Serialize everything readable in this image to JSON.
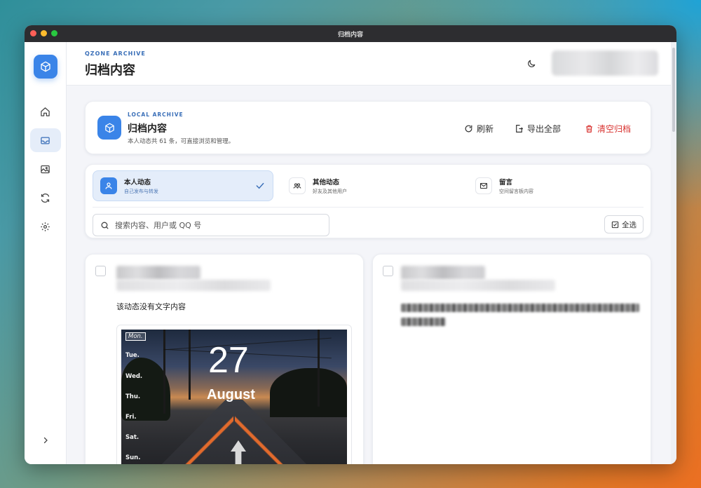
{
  "window": {
    "title": "归档内容"
  },
  "header": {
    "eyebrow": "QZONE ARCHIVE",
    "title": "归档内容"
  },
  "sidebar": {
    "items": [
      {
        "name": "home",
        "icon": "home-icon",
        "active": false
      },
      {
        "name": "archive",
        "icon": "inbox-icon",
        "active": true
      },
      {
        "name": "albums",
        "icon": "photo-icon",
        "active": false
      },
      {
        "name": "sync",
        "icon": "refresh-icon",
        "active": false
      },
      {
        "name": "settings",
        "icon": "gear-icon",
        "active": false
      }
    ]
  },
  "archive_card": {
    "eyebrow": "LOCAL ARCHIVE",
    "title": "归档内容",
    "subtitle": "本人动态共 61 条，可直接浏览和管理。",
    "actions": {
      "refresh": "刷新",
      "export": "导出全部",
      "clear": "清空归档"
    }
  },
  "tabs": [
    {
      "label": "本人动态",
      "desc": "自己发布与转发",
      "icon": "user-icon",
      "active": true
    },
    {
      "label": "其他动态",
      "desc": "好友及其他用户",
      "icon": "users-icon",
      "active": false
    },
    {
      "label": "留言",
      "desc": "空间留言板内容",
      "icon": "mail-icon",
      "active": false
    }
  ],
  "search": {
    "placeholder": "搜索内容、用户或 QQ 号"
  },
  "select_all_label": "全选",
  "posts": [
    {
      "text": "该动态没有文字内容",
      "image": {
        "days": [
          "Mon.",
          "Tue.",
          "Wed.",
          "Thu.",
          "Fri.",
          "Sat.",
          "Sun."
        ],
        "date": "27",
        "month": "August"
      }
    },
    {
      "text": ""
    }
  ],
  "colors": {
    "accent": "#3a84e8",
    "danger": "#d8322f",
    "active_tab_bg": "#e4edfa"
  }
}
